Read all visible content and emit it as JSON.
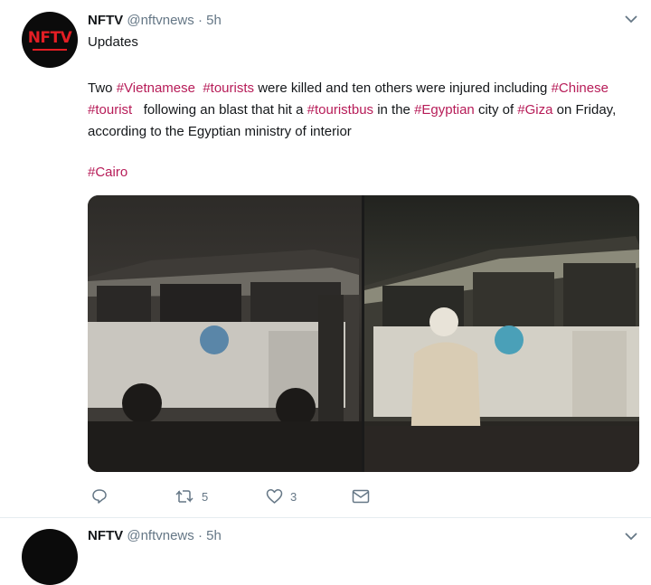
{
  "tweet": {
    "author_name": "NFTV",
    "handle": "@nftvnews",
    "separator": "·",
    "time": "5h",
    "heading": "Updates",
    "body": [
      {
        "text": "Two ",
        "hashtag": false
      },
      {
        "text": "#Vietnamese",
        "hashtag": true
      },
      {
        "text": "  ",
        "hashtag": false
      },
      {
        "text": "#tourists",
        "hashtag": true
      },
      {
        "text": " were killed and ten others were injured including ",
        "hashtag": false
      },
      {
        "text": "#Chinese",
        "hashtag": true
      },
      {
        "text": " ",
        "hashtag": false
      },
      {
        "text": "#tourist",
        "hashtag": true
      },
      {
        "text": "   following an blast that hit a ",
        "hashtag": false
      },
      {
        "text": "#touristbus",
        "hashtag": true
      },
      {
        "text": " in the ",
        "hashtag": false
      },
      {
        "text": "#Egyptian",
        "hashtag": true
      },
      {
        "text": " city of ",
        "hashtag": false
      },
      {
        "text": "#Giza",
        "hashtag": true
      },
      {
        "text": " on Friday, according to the Egyptian ministry of interior",
        "hashtag": false
      }
    ],
    "tag_line": "#Cairo",
    "actions": {
      "reply_icon": "reply-icon",
      "retweet_icon": "retweet-icon",
      "retweet_count": "5",
      "like_icon": "heart-icon",
      "like_count": "3",
      "dm_icon": "envelope-icon"
    }
  },
  "tweet2": {
    "author_name": "NFTV",
    "handle": "@nftvnews",
    "separator": "·",
    "time": "5h"
  },
  "avatar_logo": "NFTV",
  "colors": {
    "hashtag": "#b71c58",
    "muted": "#657786",
    "text": "#14171a",
    "logo_red": "#e31e24"
  }
}
